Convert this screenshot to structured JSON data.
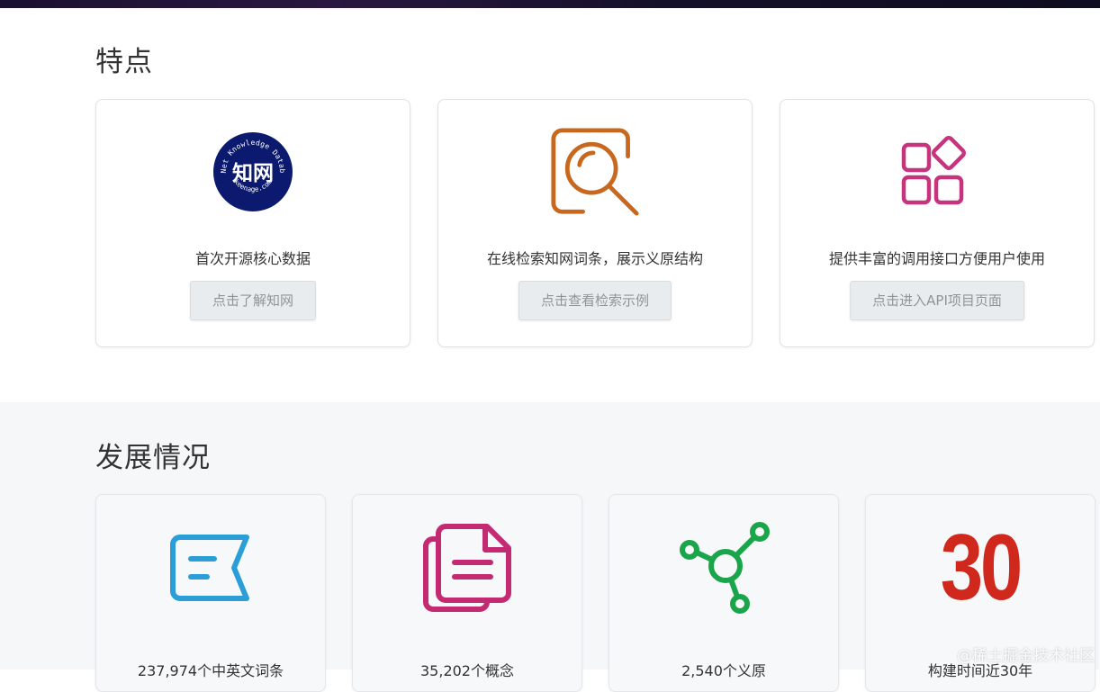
{
  "features": {
    "title": "特点",
    "cards": [
      {
        "logo": {
          "center_text": "知网",
          "ring_text_top": "HowNet Knowledge Database",
          "ring_text_bottom": "keenage.com"
        },
        "text": "首次开源核心数据",
        "button": "点击了解知网",
        "icon": "hownet-logo",
        "color": "#0b1a6e"
      },
      {
        "text": "在线检索知网词条，展示义原结构",
        "button": "点击查看检索示例",
        "icon": "search-icon",
        "color": "#c8681e"
      },
      {
        "text": "提供丰富的调用接口方便用户使用",
        "button": "点击进入API项目页面",
        "icon": "apps-icon",
        "color": "#c6347e"
      }
    ]
  },
  "development": {
    "title": "发展情况",
    "stats": [
      {
        "text": "237,974个中英文词条",
        "icon": "tag-icon",
        "color": "#2b9ed8"
      },
      {
        "text": "35,202个概念",
        "icon": "documents-icon",
        "color": "#c32a72"
      },
      {
        "text": "2,540个义原",
        "icon": "network-icon",
        "color": "#1aa54a"
      },
      {
        "text": "构建时间近30年",
        "number": "30",
        "icon": "number-30",
        "color": "#d0281c"
      }
    ]
  },
  "watermark": "@稀土掘金技术社区"
}
